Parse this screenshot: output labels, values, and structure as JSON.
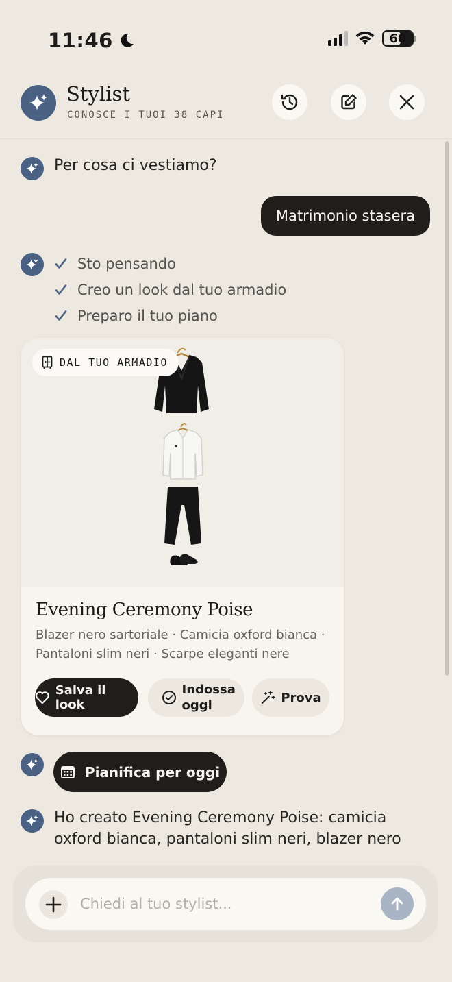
{
  "status_bar": {
    "time": "11:46",
    "battery": "60",
    "icons": [
      "moon-icon",
      "signal-icon",
      "wifi-icon",
      "battery-icon"
    ]
  },
  "header": {
    "title": "Stylist",
    "subtitle": "CONOSCE I TUOI 38 CAPI",
    "buttons": [
      "history-icon",
      "compose-icon",
      "close-icon"
    ]
  },
  "chat": {
    "greeting": "Per cosa ci vestiamo?",
    "user_message": "Matrimonio stasera",
    "steps": [
      "Sto pensando",
      "Creo un look dal tuo armadio",
      "Preparo il tuo piano"
    ],
    "look_card": {
      "badge": "DAL TUO ARMADIO",
      "title": "Evening Ceremony Poise",
      "description": "Blazer nero sartoriale · Camicia oxford bianca · Pantaloni slim neri · Scarpe eleganti nere",
      "actions": {
        "save": "Salva il look",
        "wear": "Indossa oggi",
        "try": "Prova"
      }
    },
    "plan_button": "Pianifica per oggi",
    "summary": "Ho creato Evening Ceremony Poise: camicia oxford bianca, pantaloni slim neri, blazer nero"
  },
  "composer": {
    "placeholder": "Chiedi al tuo stylist..."
  },
  "colors": {
    "accent": "#4a6184",
    "dark": "#1f1e1b",
    "background": "#ede9e1",
    "send": "#a9b5c4"
  }
}
